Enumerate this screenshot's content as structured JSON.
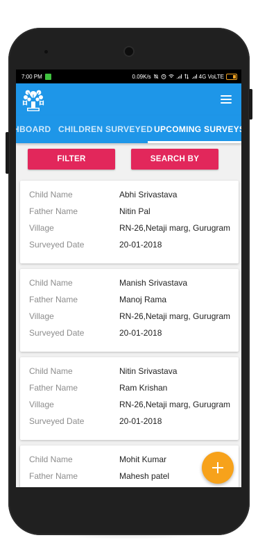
{
  "status_bar": {
    "time": "7:00 PM",
    "speed": "0.09K/s",
    "network": "4G VoLTE"
  },
  "app_bar": {
    "logo_icon": "emblem-logo-icon",
    "menu_icon": "hamburger-menu-icon"
  },
  "tabs": [
    {
      "label": "HBOARD",
      "active": false
    },
    {
      "label": "CHILDREN SURVEYED",
      "active": false
    },
    {
      "label": "UPCOMING SURVEYS",
      "active": true
    }
  ],
  "actions": {
    "filter_label": "FILTER",
    "search_label": "SEARCH BY"
  },
  "field_labels": {
    "child": "Child Name",
    "father": "Father Name",
    "village": "Village",
    "date": "Surveyed Date"
  },
  "records": [
    {
      "child": "Abhi Srivastava",
      "father": "Nitin Pal",
      "village": "RN-26,Netaji marg, Gurugram",
      "date": "20-01-2018"
    },
    {
      "child": "Manish Srivastava",
      "father": "Manoj Rama",
      "village": "RN-26,Netaji marg, Gurugram",
      "date": "20-01-2018"
    },
    {
      "child": "Nitin Srivastava",
      "father": "Ram Krishan",
      "village": "RN-26,Netaji marg, Gurugram",
      "date": "20-01-2018"
    },
    {
      "child": "Mohit Kumar",
      "father": "Mahesh patel",
      "village": "",
      "date": ""
    }
  ],
  "fab": {
    "icon": "plus-icon"
  },
  "colors": {
    "primary": "#1e96e8",
    "accent_button": "#e2275b",
    "fab": "#f7a21b"
  }
}
